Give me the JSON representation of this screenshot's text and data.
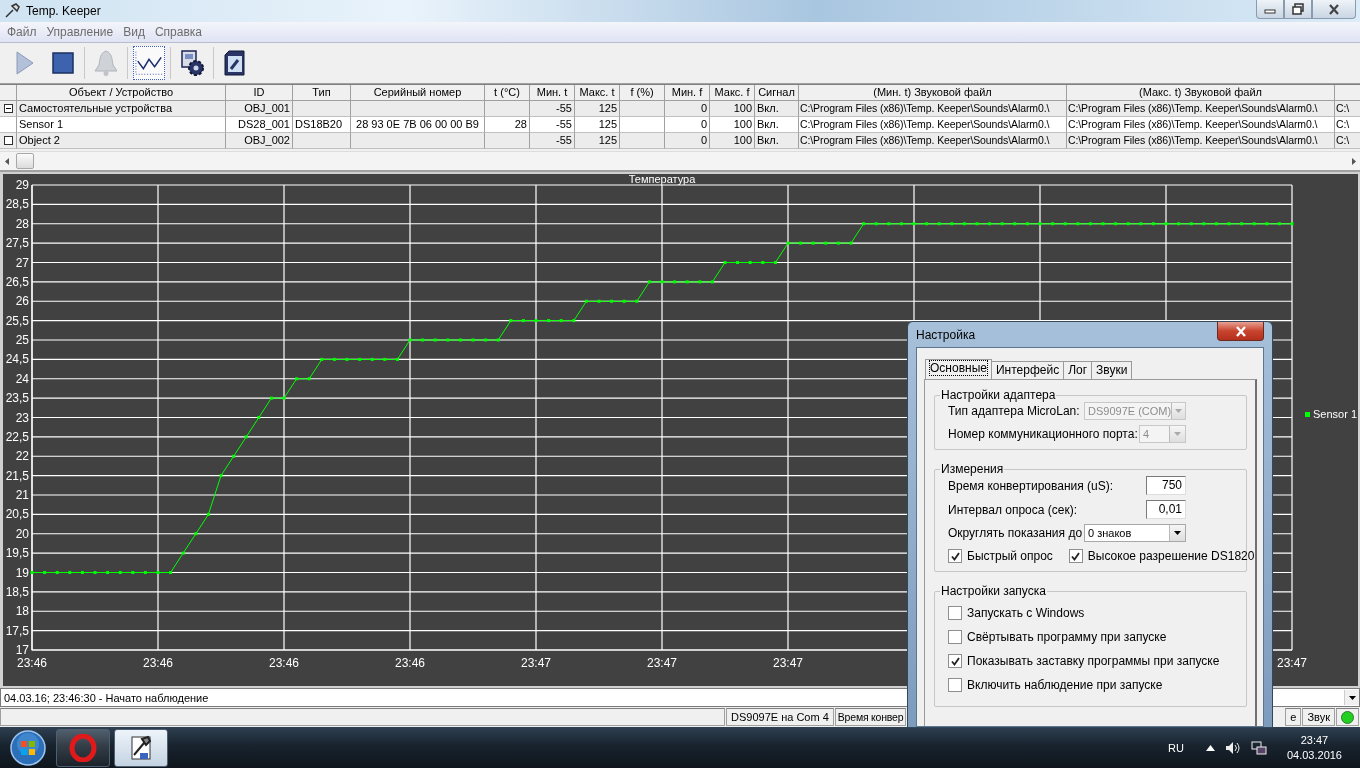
{
  "window": {
    "title": "Temp. Keeper"
  },
  "menu": [
    "Файл",
    "Управление",
    "Вид",
    "Справка"
  ],
  "toolbar": {
    "groups": [
      [
        {
          "disabled": true,
          "pressed": false
        },
        {
          "disabled": false,
          "pressed": false
        }
      ],
      [
        {
          "disabled": true,
          "pressed": false
        }
      ],
      [
        {
          "disabled": false,
          "pressed": true
        }
      ],
      [
        {
          "disabled": false,
          "pressed": false
        }
      ],
      [
        {
          "disabled": false,
          "pressed": false
        }
      ]
    ]
  },
  "table": {
    "columns": [
      "Объект / Устройство",
      "ID",
      "Тип",
      "Серийный номер",
      "t (°C)",
      "Мин. t",
      "Макс. t",
      "f (%)",
      "Мин. f",
      "Макс. f",
      "Сигнал",
      "(Мин. t) Звуковой файл",
      "(Макс. t) Звуковой файл"
    ],
    "rows": [
      {
        "kind": "group",
        "expanded": true,
        "selected": false,
        "cells": [
          "Самостоятельные устройства",
          "OBJ_001",
          null,
          null,
          null,
          "-55",
          "125",
          null,
          "0",
          "100",
          "Вкл.",
          "C:\\Program Files (x86)\\Temp. Keeper\\Sounds\\Alarm0.\\",
          "C:\\Program Files (x86)\\Temp. Keeper\\Sounds\\Alarm0.\\",
          "C:\\"
        ]
      },
      {
        "kind": "device",
        "selected": true,
        "cells": [
          "Sensor 1",
          "DS28_001",
          "DS18B20",
          "28 93 0E 7B 06 00 00 B9",
          "28",
          "-55",
          "125",
          null,
          "0",
          "100",
          "Вкл.",
          "C:\\Program Files (x86)\\Temp. Keeper\\Sounds\\Alarm0.\\",
          "C:\\Program Files (x86)\\Temp. Keeper\\Sounds\\Alarm0.\\",
          "C:\\"
        ]
      },
      {
        "kind": "group",
        "expanded": false,
        "selected": false,
        "cells": [
          "Object 2",
          "OBJ_002",
          null,
          null,
          null,
          "-55",
          "125",
          null,
          "0",
          "100",
          "Вкл.",
          "C:\\Program Files (x86)\\Temp. Keeper\\Sounds\\Alarm0.\\",
          "C:\\Program Files (x86)\\Temp. Keeper\\Sounds\\Alarm0.\\",
          "C:\\"
        ]
      }
    ]
  },
  "chart": {
    "chart_data": {
      "type": "line",
      "title": "Температура",
      "grid": true,
      "ylim": [
        17,
        29
      ],
      "categories": [
        "23:46",
        null,
        null,
        null,
        null,
        null,
        null,
        null,
        null,
        null,
        "23:46",
        null,
        null,
        null,
        null,
        null,
        null,
        null,
        null,
        null,
        "23:46",
        null,
        null,
        null,
        null,
        null,
        null,
        null,
        null,
        null,
        "23:46",
        null,
        null,
        null,
        null,
        null,
        null,
        null,
        null,
        null,
        "23:47",
        null,
        null,
        null,
        null,
        null,
        null,
        null,
        null,
        null,
        "23:47",
        null,
        null,
        null,
        null,
        null,
        null,
        null,
        null,
        null,
        "23:47",
        null,
        null,
        null,
        null,
        null,
        null,
        null,
        null,
        null,
        null,
        null,
        null,
        null,
        null,
        null,
        null,
        null,
        null,
        null,
        null,
        null,
        null,
        null,
        null,
        null,
        null,
        null,
        null,
        null,
        null,
        null,
        null,
        null,
        null,
        null,
        null,
        null,
        null,
        null,
        "23:47"
      ],
      "yticks": [
        17,
        {
          "value": 17.5,
          "label": "17,5"
        },
        18,
        {
          "value": 18.5,
          "label": "18,5"
        },
        19,
        {
          "value": 19.5,
          "label": "19,5"
        },
        20,
        {
          "value": 20.5,
          "label": "20,5"
        },
        21,
        {
          "value": 21.5,
          "label": "21,5"
        },
        22,
        {
          "value": 22.5,
          "label": "22,5"
        },
        23,
        {
          "value": 23.5,
          "label": "23,5"
        },
        24,
        {
          "value": 24.5,
          "label": "24,5"
        },
        25,
        {
          "value": 25.5,
          "label": "25,5"
        },
        26,
        {
          "value": 26.5,
          "label": "26,5"
        },
        27,
        {
          "value": 27.5,
          "label": "27,5"
        },
        28,
        {
          "value": 28.5,
          "label": "28,5"
        },
        29
      ],
      "series": [
        {
          "name": "Sensor 1",
          "color": "#00ff00",
          "marker": "square",
          "values": [
            19,
            19,
            19,
            19,
            19,
            19,
            19,
            19,
            19,
            19,
            19,
            19,
            19.5,
            20,
            20.5,
            21.5,
            22,
            22.5,
            23,
            23.5,
            23.5,
            24,
            24,
            24.5,
            24.5,
            24.5,
            24.5,
            24.5,
            24.5,
            24.5,
            25,
            25,
            25,
            25,
            25,
            25,
            25,
            25,
            25.5,
            25.5,
            25.5,
            25.5,
            25.5,
            25.5,
            26,
            26,
            26,
            26,
            26,
            26.5,
            26.5,
            26.5,
            26.5,
            26.5,
            26.5,
            27,
            27,
            27,
            27,
            27,
            27.5,
            27.5,
            27.5,
            27.5,
            27.5,
            27.5,
            28,
            28,
            28,
            28,
            28,
            28,
            28,
            28,
            28,
            28,
            28,
            28,
            28,
            28,
            28,
            28,
            28,
            28,
            28,
            28,
            28,
            28,
            28,
            28,
            28,
            28,
            28,
            28,
            28,
            28,
            28,
            28,
            28,
            28,
            28
          ]
        }
      ]
    }
  },
  "status_bar": {
    "log": "04.03.16; 23:46:30 - Начато наблюдение",
    "panels": [
      "DS9097E на Com 4",
      "Время конвер",
      "е"
    ],
    "sound": {
      "label": "Звук",
      "on": true
    }
  },
  "dialog": {
    "title": "Настройка",
    "tabs": [
      {
        "label": "Основные",
        "selected": true
      },
      {
        "label": "Интерфейс",
        "selected": false
      },
      {
        "label": "Лог",
        "selected": false
      },
      {
        "label": "Звуки",
        "selected": false
      }
    ],
    "groups": [
      {
        "title": "Настройки адаптера",
        "rows": [
          {
            "kind": "combo",
            "label": "Тип адаптера MicroLan:",
            "value": "DS9097E (COM)",
            "disabled": true
          },
          {
            "kind": "combo",
            "label": "Номер коммуникационного порта:",
            "value": "4",
            "disabled": true
          }
        ]
      },
      {
        "title": "Измерения",
        "rows": [
          {
            "kind": "input",
            "label": "Время конвертирования (uS):",
            "value": "750"
          },
          {
            "kind": "input",
            "label": "Интервал опроса (сек):",
            "value": "0,01"
          },
          {
            "kind": "combo",
            "label": "Округлять показания до",
            "value": "0 знаков",
            "disabled": false
          },
          {
            "kind": "checks",
            "items": [
              {
                "label": "Быстрый опрос",
                "checked": true
              },
              {
                "label": "Высокое разрешение DS1820",
                "checked": true
              }
            ]
          }
        ]
      },
      {
        "title": "Настройки запуска",
        "rows": [
          {
            "kind": "check",
            "label": "Запускать с Windows",
            "checked": false
          },
          {
            "kind": "check",
            "label": "Свёртывать программу при запуске",
            "checked": false
          },
          {
            "kind": "check",
            "label": "Показывать заставку программы при запуске",
            "checked": true
          },
          {
            "kind": "check",
            "label": "Включить наблюдение при запуске",
            "checked": false
          }
        ]
      }
    ]
  },
  "taskbar": {
    "language": "RU",
    "time": "23:47",
    "date": "04.03.2016"
  }
}
